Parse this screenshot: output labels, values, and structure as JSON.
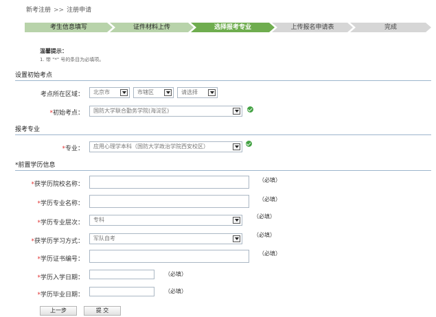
{
  "breadcrumb": {
    "root": "新考注册",
    "separator": ">>",
    "current": "注册申请"
  },
  "steps": [
    "考生信息填写",
    "证件材料上传",
    "选择报考专业",
    "上传报名申请表",
    "完成"
  ],
  "tips": {
    "title": "温馨提示：",
    "body": "1. 带 \"*\" 号的条目为必填项。"
  },
  "required_mark": "*",
  "sections": {
    "initial_site": "设置初始考点",
    "major": "报考专业",
    "prior_edu": "*前置学历信息"
  },
  "initial_site": {
    "region_label": "考点所在区域：",
    "city": "北京市",
    "district": "市辖区",
    "select_placeholder": "请选择",
    "site_label": "初始考点：",
    "site": "国防大学联合勤务学院(海淀区)"
  },
  "major": {
    "label": "专业：",
    "value": "应用心理学本科（国防大学政治学院西安校区）"
  },
  "prior_edu": {
    "school_label": "获学历院校名称：",
    "major_label": "学历专业名称：",
    "level_label": "学历专业层次：",
    "level_value": "专科",
    "mode_label": "获学历学习方式：",
    "mode_value": "军队自考",
    "cert_label": "学历证书编号：",
    "start_label": "学历入学日期：",
    "grad_label": "学历毕业日期：",
    "required_hint": "（必填）"
  },
  "buttons": {
    "prev": "上一步",
    "submit": "提 交"
  },
  "colors": {
    "step_active": "#6fad4f",
    "step_done": "#b8d3aa",
    "step_todo": "#d6d6d6",
    "required": "#e03030",
    "ok": "#44a244"
  }
}
